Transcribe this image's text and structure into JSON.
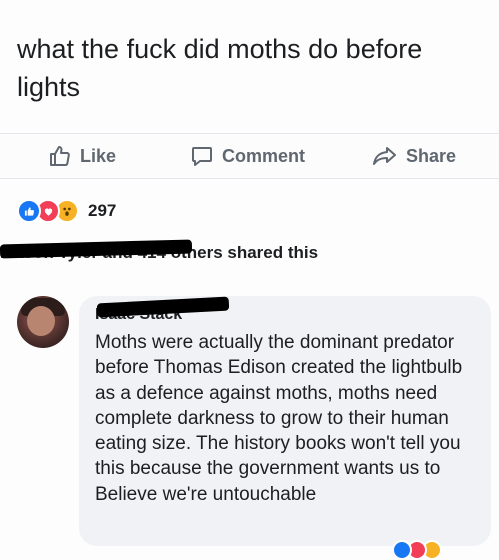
{
  "post": {
    "text": "what the fuck did moths do before lights"
  },
  "actions": {
    "like_label": "Like",
    "comment_label": "Comment",
    "share_label": "Share"
  },
  "reactions": {
    "icons": [
      "like-icon",
      "love-icon",
      "wow-icon"
    ],
    "count": "297",
    "colors": {
      "like": "#1877f2",
      "love": "#f33e58",
      "wow": "#f7b125"
    }
  },
  "shared": {
    "names": "Mason Tyler and 414",
    "suffix": " others shared this"
  },
  "comment": {
    "author": "Isaac Stack",
    "text": "Moths were actually the dominant predator before Thomas Edison created the lightbulb as a defence against moths, moths need complete darkness to grow to their human eating size. The history books won't tell you this because the government wants us to Believe we're untouchable"
  }
}
